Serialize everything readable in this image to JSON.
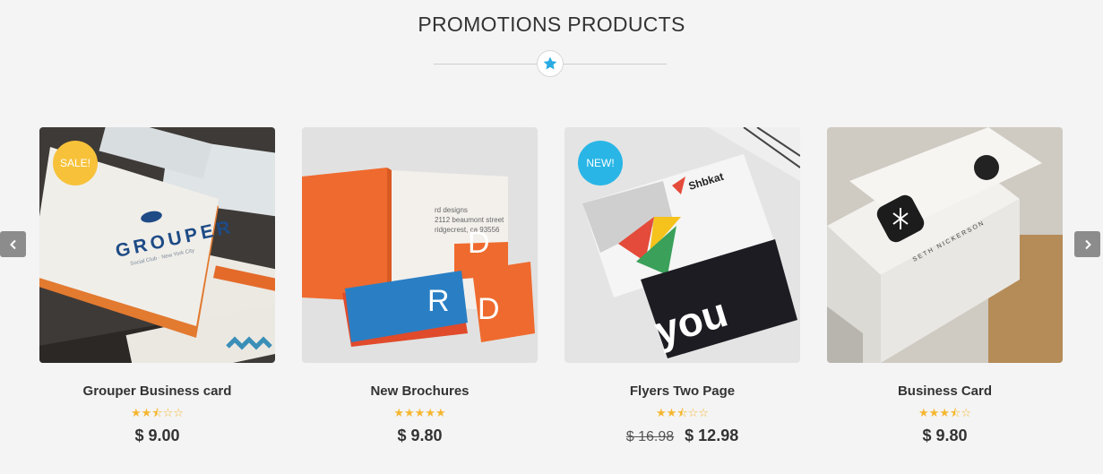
{
  "section": {
    "title": "PROMOTIONS PRODUCTS"
  },
  "colors": {
    "accent": "#29abe2",
    "sale_tag": "#f7c23a",
    "new_tag": "#29b6e6",
    "star": "#f5b731"
  },
  "products": [
    {
      "name": "Grouper Business card",
      "price": "$ 9.00",
      "old_price": "",
      "tag": "SALE!",
      "rating": 2.5,
      "stars": "★★☆☆☆"
    },
    {
      "name": "New Brochures",
      "price": "$ 9.80",
      "old_price": "",
      "tag": "",
      "rating": 5,
      "stars": "★★★★★"
    },
    {
      "name": "Flyers Two Page",
      "price": "$ 12.98",
      "old_price": "$ 16.98",
      "tag": "NEW!",
      "rating": 2.5,
      "stars": "★★☆☆☆"
    },
    {
      "name": "Business Card",
      "price": "$ 9.80",
      "old_price": "",
      "tag": "",
      "rating": 3.5,
      "stars": "★★★☆☆"
    }
  ],
  "icons": {
    "divider": "star-icon",
    "prev": "chevron-left-icon",
    "next": "chevron-right-icon"
  }
}
